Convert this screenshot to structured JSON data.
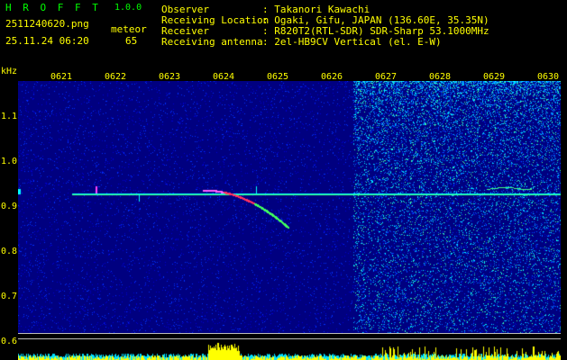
{
  "app": {
    "title": "H R O F F T",
    "version": "1.0.0"
  },
  "file": {
    "name": "2511240620.png",
    "datetime": "25.11.24 06:20"
  },
  "meteor": {
    "label": "meteor",
    "count": "65"
  },
  "info": [
    {
      "key": "Observer",
      "value": ": Takanori Kawachi"
    },
    {
      "key": "Receiving Location",
      "value": ": Ogaki, Gifu, JAPAN (136.60E, 35.35N)"
    },
    {
      "key": "Receiver",
      "value": ": R820T2(RTL-SDR) SDR-Sharp 53.1000MHz"
    },
    {
      "key": "Receiving antenna",
      "value": ": 2el-HB9CV Vertical (el. E-W)"
    }
  ],
  "axis": {
    "unit": "kHz",
    "y_labels": [
      "1.1",
      "1.0",
      "0.9",
      "0.8",
      "0.7",
      "0.6"
    ],
    "times": [
      "0621",
      "0622",
      "0623",
      "0624",
      "0625",
      "0626",
      "0627",
      "0628",
      "0629",
      "0630"
    ]
  },
  "colors": {
    "label": "#ffff00",
    "title": "#00ff00",
    "background": "#000080"
  }
}
